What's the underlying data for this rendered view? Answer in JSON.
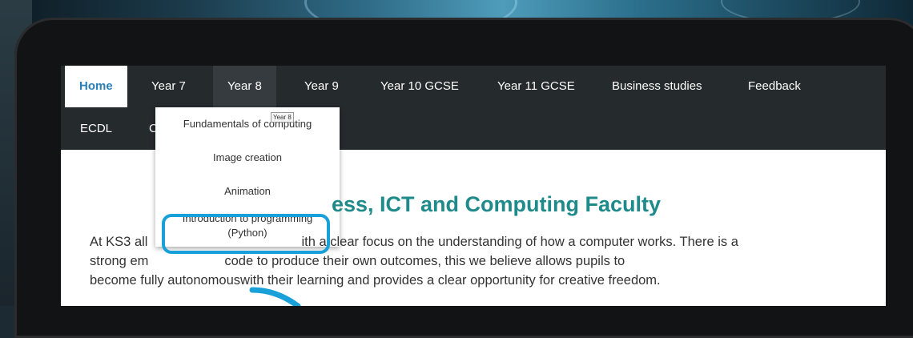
{
  "nav": {
    "row1": [
      "Home",
      "Year 7",
      "Year 8",
      "Year 9",
      "Year 10 GCSE",
      "Year 11 GCSE",
      "Business studies",
      "Feedback"
    ],
    "row2": [
      "ECDL",
      "C"
    ]
  },
  "dropdown": {
    "items": [
      "Fundamentals of computing",
      "Image creation",
      "Animation",
      "Introduction to programming (Python)"
    ],
    "item4_line1": "Introduction to programming",
    "item4_line2": "(Python)"
  },
  "tooltip": "Year 8",
  "page": {
    "heading": "ess, ICT and Computing Faculty",
    "para_line1_a": "At KS3 all",
    "para_line1_b": "ith a clear focus on the understanding of how a computer works.  There is a",
    "para_line2_a": "strong em",
    "para_line2_b": "code to produce their own outcomes, this we believe allows pupils to",
    "para_line3_a": "become fully autonomous",
    "para_line3_b": "with their learning and provides a clear opportunity for creative freedom."
  },
  "colors": {
    "nav_bg": "#252a2d",
    "accent": "#1aa0d8",
    "heading": "#1f8a8a",
    "home_link": "#2a7fb8"
  }
}
